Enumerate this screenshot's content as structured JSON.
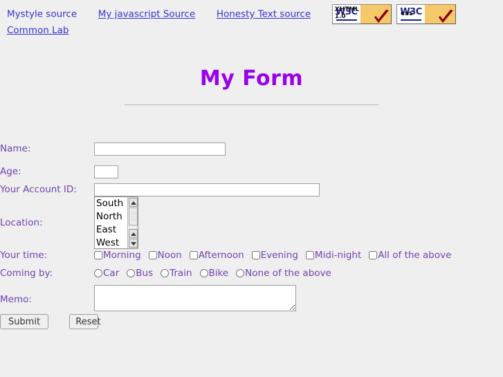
{
  "topnav": {
    "links": [
      {
        "label": "Mystyle source",
        "underlined": false
      },
      {
        "label": "My javascript Source",
        "underlined": true
      },
      {
        "label": "Honesty Text source",
        "underlined": true
      },
      {
        "label": "Common Lab",
        "underlined": true
      }
    ],
    "badges": [
      {
        "left": "W3C",
        "right_line1": "XHTML",
        "right_line2": "1.0",
        "name": "valid-xhtml-badge"
      },
      {
        "left": "W3C",
        "right_line1": "css",
        "right_line2": "",
        "name": "valid-css-badge"
      }
    ],
    "link_color": "#3333cc"
  },
  "heading": {
    "title": "My Form",
    "color": "#9900ee"
  },
  "form": {
    "label_color": "#7043ad",
    "fields": {
      "name": {
        "label": "Name:",
        "value": "",
        "placeholder": ""
      },
      "age": {
        "label": "Age:",
        "value": "",
        "placeholder": ""
      },
      "account": {
        "label": "Your Account ID:",
        "value": "",
        "placeholder": ""
      },
      "location": {
        "label": "Location:",
        "options": [
          "South",
          "North",
          "East",
          "West"
        ],
        "selected": ""
      },
      "time": {
        "label": "Your time:",
        "options": [
          "Morning",
          "Noon",
          "Afternoon",
          "Evening",
          "Midi-night",
          "All of the above"
        ],
        "checked": []
      },
      "coming_by": {
        "label": "Coming by:",
        "options": [
          "Car",
          "Bus",
          "Train",
          "Bike",
          "None of the above"
        ],
        "selected": ""
      },
      "memo": {
        "label": "Memo:",
        "value": "",
        "placeholder": ""
      }
    },
    "buttons": {
      "submit": "Submit",
      "reset": "Reset"
    }
  }
}
